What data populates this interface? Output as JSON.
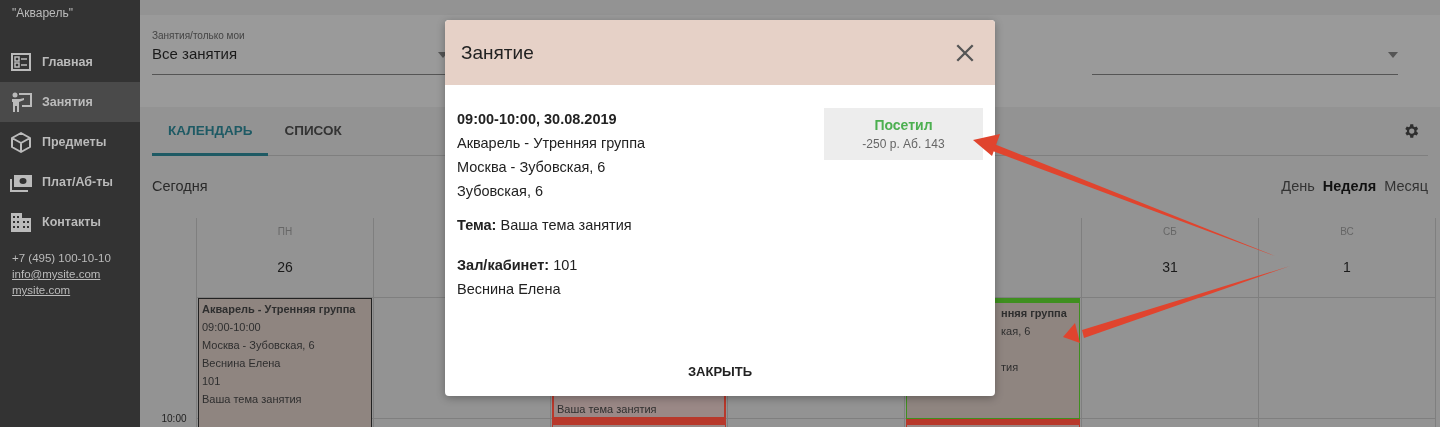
{
  "sidebar": {
    "title": "\"Акварель\"",
    "items": [
      {
        "label": "Главная",
        "selected": false
      },
      {
        "label": "Занятия",
        "selected": true
      },
      {
        "label": "Предметы",
        "selected": false
      },
      {
        "label": "Плат/Аб-ты",
        "selected": false
      },
      {
        "label": "Контакты",
        "selected": false
      }
    ],
    "phone": "+7 (495) 100-10-10",
    "email": "info@mysite.com",
    "site": "mysite.com"
  },
  "filter": {
    "label": "Занятия/только мои",
    "value": "Все занятия"
  },
  "tabs": [
    {
      "label": "КАЛЕНДАРЬ",
      "selected": true
    },
    {
      "label": "СПИСОК",
      "selected": false
    }
  ],
  "today": "Сегодня",
  "views": [
    {
      "label": "День",
      "selected": false
    },
    {
      "label": "Неделя",
      "selected": true
    },
    {
      "label": "Месяц",
      "selected": false
    }
  ],
  "calendar": {
    "times": [
      "10:00"
    ],
    "days": [
      {
        "kind": "shown",
        "weekday": "ПН",
        "date": "26",
        "events": [
          {
            "kind": "full",
            "color": "#222222",
            "title": "Акварель - Утренняя группа",
            "lines": [
              "09:00-10:00",
              "Москва - Зубовская, 6",
              "Веснина Елена",
              "101",
              "Ваша тема занятия"
            ]
          }
        ]
      },
      {
        "kind": "covered"
      },
      {
        "kind": "covered",
        "events": [
          {
            "kind": "tail",
            "color": "#b8382b",
            "lines": [
              "Ваша тема занятия"
            ]
          },
          {
            "kind": "stub",
            "color": "#b8382b"
          }
        ]
      },
      {
        "kind": "covered"
      },
      {
        "kind": "covered",
        "events": [
          {
            "kind": "clipped",
            "color": "#3f8f1f",
            "title": "нняя группа",
            "lines": [
              "кая, 6",
              "тия"
            ]
          },
          {
            "kind": "stub",
            "color": "#b8382b"
          }
        ]
      },
      {
        "kind": "shown",
        "weekday": "СБ",
        "date": "31"
      },
      {
        "kind": "shown",
        "weekday": "ВС",
        "date": "1"
      }
    ]
  },
  "dialog": {
    "title": "Занятие",
    "heading": "09:00-10:00, 30.08.2019",
    "lines": [
      "Акварель - Утренняя группа",
      "Москва - Зубовская, 6",
      "Зубовская, 6"
    ],
    "topic": "**Тема:** Ваша тема занятия",
    "room": "**Зал/кабинет:** 101",
    "teacher": "Веснина Елена",
    "status": {
      "label": "Посетил",
      "detail": "-250 р. Аб. 143"
    },
    "button": "ЗАКРЫТЬ"
  }
}
